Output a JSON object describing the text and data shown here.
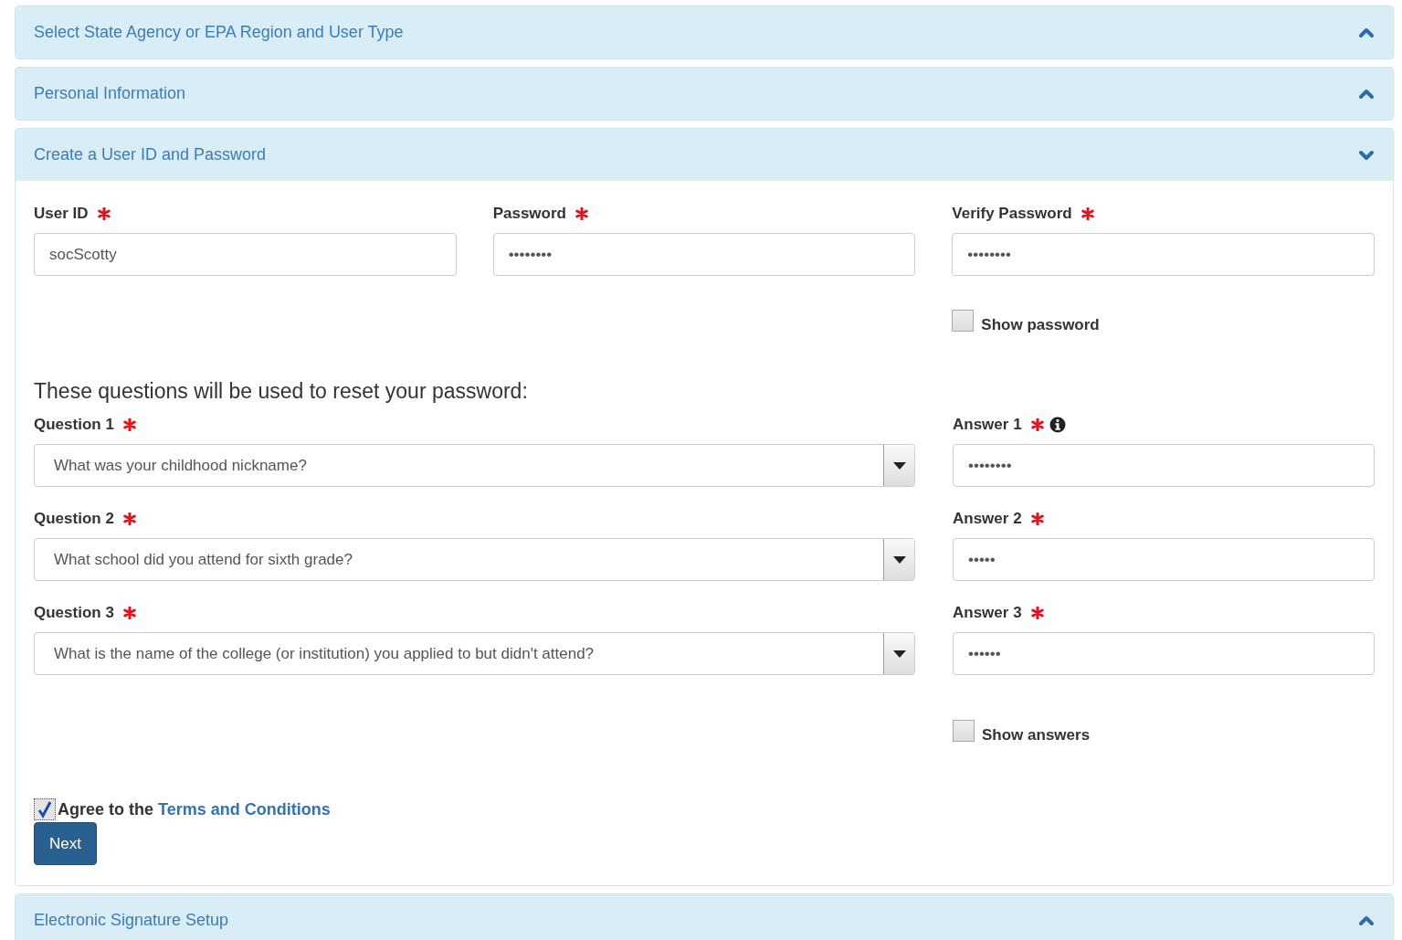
{
  "sections": [
    {
      "title": "Select State Agency or EPA Region and User Type",
      "expanded": false
    },
    {
      "title": "Personal Information",
      "expanded": false
    },
    {
      "title": "Create a User ID and Password",
      "expanded": true,
      "form": {
        "fields": [
          {
            "label": "User ID",
            "required": true,
            "value": "socScotty"
          },
          {
            "label": "Password",
            "required": true,
            "value": "••••••••"
          },
          {
            "label": "Verify Password",
            "required": true,
            "value": "••••••••"
          }
        ],
        "show_password": {
          "label": "Show password",
          "checked": false
        },
        "questions_heading": "These questions will be used to reset your password:",
        "questions": [
          {
            "label": "Question 1",
            "required": true,
            "value": "What was your childhood nickname?",
            "answer_label": "Answer 1",
            "answer_required": true,
            "answer_info": true,
            "answer_value": "••••••••"
          },
          {
            "label": "Question 2",
            "required": true,
            "value": "What school did you attend for sixth grade?",
            "answer_label": "Answer 2",
            "answer_required": true,
            "answer_info": false,
            "answer_value": "•••••"
          },
          {
            "label": "Question 3",
            "required": true,
            "value": "What is the name of the college (or institution) you applied to but didn't attend?",
            "answer_label": "Answer 3",
            "answer_required": true,
            "answer_info": false,
            "answer_value": "••••••"
          }
        ],
        "show_answers": {
          "label": "Show answers",
          "checked": false
        },
        "agree": {
          "text": "Agree to the",
          "link": "Terms and Conditions",
          "checked": true
        },
        "next_button": "Next"
      }
    },
    {
      "title": "Electronic Signature Setup",
      "expanded": false
    }
  ]
}
